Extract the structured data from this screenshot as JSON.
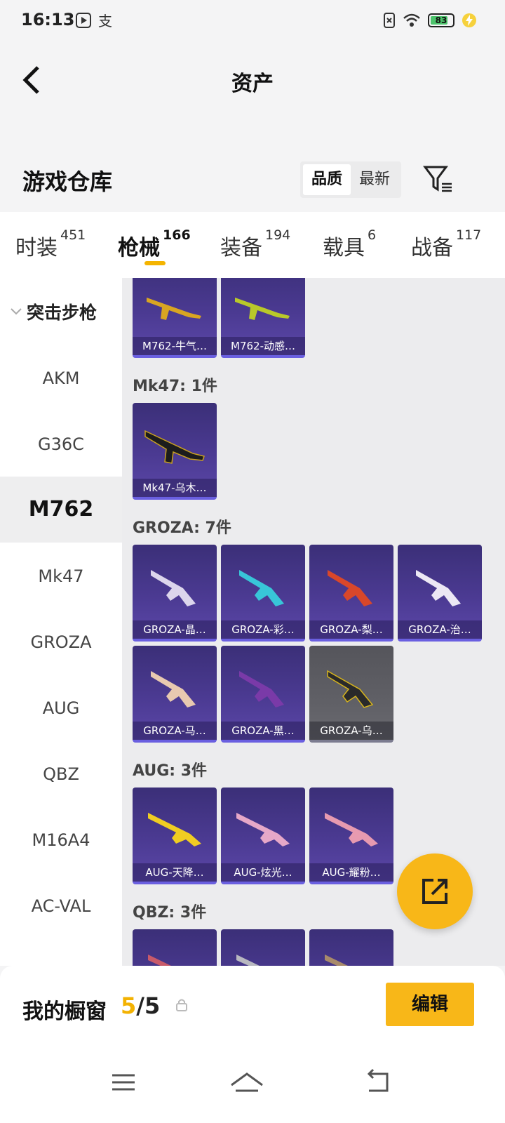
{
  "status_bar": {
    "time": "16:13",
    "battery": "83"
  },
  "header": {
    "title": "资产"
  },
  "warehouse": {
    "title": "游戏仓库",
    "sort_options": [
      "品质",
      "最新"
    ]
  },
  "tabs": [
    {
      "label": "时装",
      "count": "451"
    },
    {
      "label": "枪械",
      "count": "166"
    },
    {
      "label": "装备",
      "count": "194"
    },
    {
      "label": "载具",
      "count": "6"
    },
    {
      "label": "战备",
      "count": "117"
    }
  ],
  "sidebar": {
    "group": "突击步枪",
    "items": [
      "AKM",
      "G36C",
      "M762",
      "Mk47",
      "GROZA",
      "AUG",
      "QBZ",
      "M16A4",
      "AC-VAL"
    ]
  },
  "content": {
    "m762_cards": [
      "M762-牛气…",
      "M762-动感…"
    ],
    "mk47": {
      "label": "Mk47: 1件",
      "cards": [
        "Mk47-乌木…"
      ]
    },
    "groza": {
      "label": "GROZA: 7件",
      "cards": [
        "GROZA-晶…",
        "GROZA-彩…",
        "GROZA-梨…",
        "GROZA-治…",
        "GROZA-马…",
        "GROZA-黑…",
        "GROZA-乌…"
      ]
    },
    "aug": {
      "label": "AUG: 3件",
      "cards": [
        "AUG-天降…",
        "AUG-炫光…",
        "AUG-耀粉…"
      ]
    },
    "qbz": {
      "label": "QBZ: 3件"
    }
  },
  "showcase": {
    "label": "我的橱窗",
    "current": "5",
    "total": "/5",
    "edit_label": "编辑"
  },
  "colors": {
    "accent": "#f8b718",
    "card_purple": "#4b3a92"
  }
}
